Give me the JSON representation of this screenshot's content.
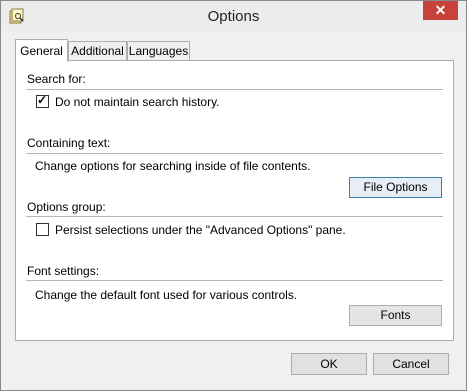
{
  "window": {
    "title": "Options",
    "close_glyph": "✕"
  },
  "tabs": [
    {
      "label": "General"
    },
    {
      "label": "Additional"
    },
    {
      "label": "Languages"
    }
  ],
  "general": {
    "search_for": {
      "label": "Search for:",
      "checkbox_label": "Do not maintain search history.",
      "checked": true
    },
    "containing_text": {
      "label": "Containing text:",
      "description": "Change options for searching inside of file contents.",
      "button_label": "File Options"
    },
    "options_group": {
      "label": "Options group:",
      "checkbox_label": "Persist selections under the \"Advanced Options\" pane.",
      "checked": false
    },
    "font_settings": {
      "label": "Font settings:",
      "description": "Change the default font used for various controls.",
      "button_label": "Fonts"
    }
  },
  "footer": {
    "ok_label": "OK",
    "cancel_label": "Cancel"
  }
}
